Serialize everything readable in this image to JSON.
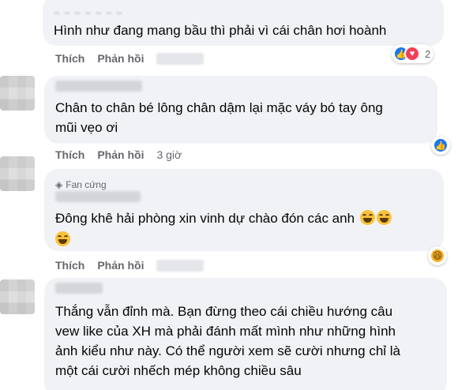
{
  "comments": [
    {
      "text": "Hình như đang mang bầu thì phải vì cái chân hơi hoành",
      "like": "Thích",
      "reply": "Phản hồi",
      "reactions": {
        "count": "2",
        "icons": [
          "like-icon",
          "love-icon"
        ]
      }
    },
    {
      "text_line1": "Chân to chân bé lông chân dậm lại mặc váy bó tay ông",
      "text_line2": "mũi vẹo ơi",
      "like": "Thích",
      "reply": "Phản hồi",
      "time": "3 giờ",
      "reactions": {
        "icons": [
          "like-icon"
        ]
      }
    },
    {
      "badge": "Fan cứng",
      "text": "Đông khê hải phòng xin vinh dự chào đón các anh",
      "like": "Thích",
      "reply": "Phản hồi",
      "reactions": {
        "icons": [
          "haha-icon"
        ]
      }
    },
    {
      "text_line1": "Thắng vẫn đỉnh mà. Bạn đừng theo cái chiều hướng câu",
      "text_line2": "vew like của XH mà phải đánh mất mình như những hình",
      "text_line3": "ảnh kiểu như này. Có thể người xem sẽ cười nhưng chỉ là",
      "text_line4": "một cái cười nhếch mép không chiều sâu"
    }
  ],
  "colors": {
    "bubble": "#f0f2f5",
    "meta": "#65676b",
    "like_blue": "#1877f2",
    "love_red": "#f33e58",
    "haha_yellow": "#f7b125"
  }
}
